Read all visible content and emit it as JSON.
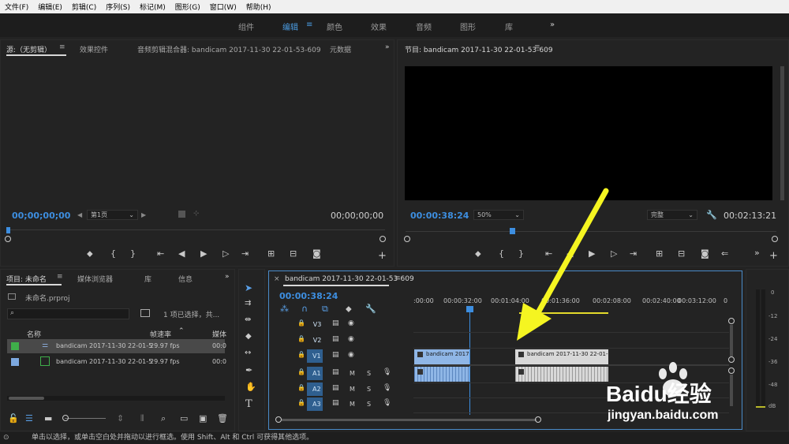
{
  "menu": [
    "文件(F)",
    "编辑(E)",
    "剪辑(C)",
    "序列(S)",
    "标记(M)",
    "图形(G)",
    "窗口(W)",
    "帮助(H)"
  ],
  "workspaces": [
    "组件",
    "编辑",
    "颜色",
    "效果",
    "音频",
    "图形",
    "库"
  ],
  "workspace_active_index": 1,
  "source_panel": {
    "tabs": [
      "源:（无剪辑）",
      "效果控件",
      "音频剪辑混合器: bandicam 2017-11-30 22-01-53-609",
      "元数据"
    ],
    "timecode_left": "00;00;00;00",
    "timecode_right": "00;00;00;00",
    "page_select": "第1页"
  },
  "program_panel": {
    "title": "节目: bandicam 2017-11-30 22-01-53-609",
    "timecode": "00:00:38:24",
    "zoom": "50%",
    "quality": "完整",
    "duration": "00:02:13:21"
  },
  "project_panel": {
    "tabs": [
      "项目: 未命名",
      "媒体浏览器",
      "库",
      "信息"
    ],
    "file": "未命名.prproj",
    "selection_status": "1 项已选择，共...",
    "columns": [
      "名称",
      "帧速率",
      "媒体"
    ],
    "items": [
      {
        "name": "bandicam 2017-11-30 22-01-5",
        "fps": "29.97 fps",
        "media": "00:0",
        "color": "#3fae4a"
      },
      {
        "name": "bandicam 2017-11-30 22-01-5",
        "fps": "29.97 fps",
        "media": "00:0",
        "color": "#7da9e0"
      }
    ]
  },
  "timeline": {
    "title": "bandicam 2017-11-30 22-01-53-609",
    "timecode": "00:00:38:24",
    "ruler": [
      ":00:00",
      "00:00:32:00",
      "00:01:04:00",
      "00:01:36:00",
      "00:02:08:00",
      "00:02:40:00",
      "00:03:12:00",
      "0"
    ],
    "video_tracks": [
      "V3",
      "V2",
      "V1"
    ],
    "audio_tracks": [
      "A1",
      "A2",
      "A3"
    ],
    "clip_labels": [
      "bandicam 2017-",
      "bandicam 2017-11-30 22-01-53-"
    ],
    "mixer_labels": [
      "0",
      "-12",
      "-24",
      "-36",
      "-48",
      "dB"
    ]
  },
  "status_text": "单击以选择，或单击空白处并拖动以进行框选。使用 Shift、Alt 和 Ctrl 可获得其他选项。",
  "watermark": {
    "brand": "Baidu经验",
    "url": "jingyan.baidu.com"
  },
  "annotation_color": "#f5f521"
}
